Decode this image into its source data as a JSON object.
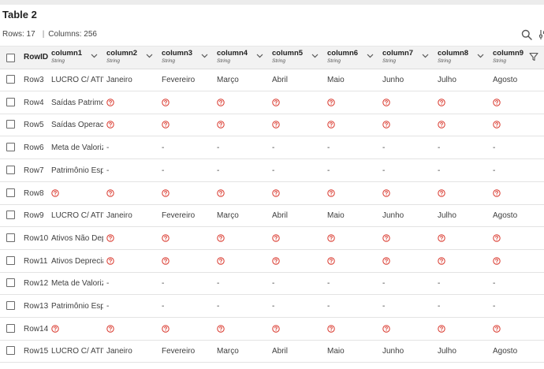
{
  "table": {
    "title": "Table 2",
    "rows_label": "Rows: 17",
    "separator": "|",
    "columns_label": "Columns: 256"
  },
  "header": {
    "rowid": "RowID",
    "columns": [
      {
        "name": "column1",
        "type": "String"
      },
      {
        "name": "column2",
        "type": "String"
      },
      {
        "name": "column3",
        "type": "String"
      },
      {
        "name": "column4",
        "type": "String"
      },
      {
        "name": "column5",
        "type": "String"
      },
      {
        "name": "column6",
        "type": "String"
      },
      {
        "name": "column7",
        "type": "String"
      },
      {
        "name": "column8",
        "type": "String"
      },
      {
        "name": "column9",
        "type": "String"
      }
    ]
  },
  "icons": {
    "search": "search-icon",
    "settings": "sliders-icon",
    "filter": "filter-icon",
    "missing": "missing-value-icon",
    "sort": "chevron-down-icon"
  },
  "colors": {
    "missing": "#d9362b",
    "header_bg": "#f2f2f2"
  },
  "rows": [
    {
      "id": "Row3",
      "cells": [
        "LUCRO C/ ATIV",
        "Janeiro",
        "Fevereiro",
        "Março",
        "Abril",
        "Maio",
        "Junho",
        "Julho",
        "Agosto"
      ]
    },
    {
      "id": "Row4",
      "cells": [
        "Saídas Patrimo",
        null,
        null,
        null,
        null,
        null,
        null,
        null,
        null
      ]
    },
    {
      "id": "Row5",
      "cells": [
        "Saídas Operaci",
        null,
        null,
        null,
        null,
        null,
        null,
        null,
        null
      ]
    },
    {
      "id": "Row6",
      "cells": [
        "Meta de Valoriz",
        "-",
        "-",
        "-",
        "-",
        "-",
        "-",
        "-",
        "-"
      ]
    },
    {
      "id": "Row7",
      "cells": [
        "Patrimônio Esp",
        "-",
        "-",
        "-",
        "-",
        "-",
        "-",
        "-",
        "-"
      ]
    },
    {
      "id": "Row8",
      "cells": [
        null,
        null,
        null,
        null,
        null,
        null,
        null,
        null,
        null
      ]
    },
    {
      "id": "Row9",
      "cells": [
        "LUCRO C/ ATIV",
        "Janeiro",
        "Fevereiro",
        "Março",
        "Abril",
        "Maio",
        "Junho",
        "Julho",
        "Agosto"
      ]
    },
    {
      "id": "Row10",
      "cells": [
        "Ativos Não Dep",
        null,
        null,
        null,
        null,
        null,
        null,
        null,
        null
      ]
    },
    {
      "id": "Row11",
      "cells": [
        "Ativos Depreciá",
        null,
        null,
        null,
        null,
        null,
        null,
        null,
        null
      ]
    },
    {
      "id": "Row12",
      "cells": [
        "Meta de Valoriz",
        "-",
        "-",
        "-",
        "-",
        "-",
        "-",
        "-",
        "-"
      ]
    },
    {
      "id": "Row13",
      "cells": [
        "Patrimônio Esp",
        "-",
        "-",
        "-",
        "-",
        "-",
        "-",
        "-",
        "-"
      ]
    },
    {
      "id": "Row14",
      "cells": [
        null,
        null,
        null,
        null,
        null,
        null,
        null,
        null,
        null
      ]
    },
    {
      "id": "Row15",
      "cells": [
        "LUCRO C/ ATIV",
        "Janeiro",
        "Fevereiro",
        "Março",
        "Abril",
        "Maio",
        "Junho",
        "Julho",
        "Agosto"
      ]
    }
  ]
}
